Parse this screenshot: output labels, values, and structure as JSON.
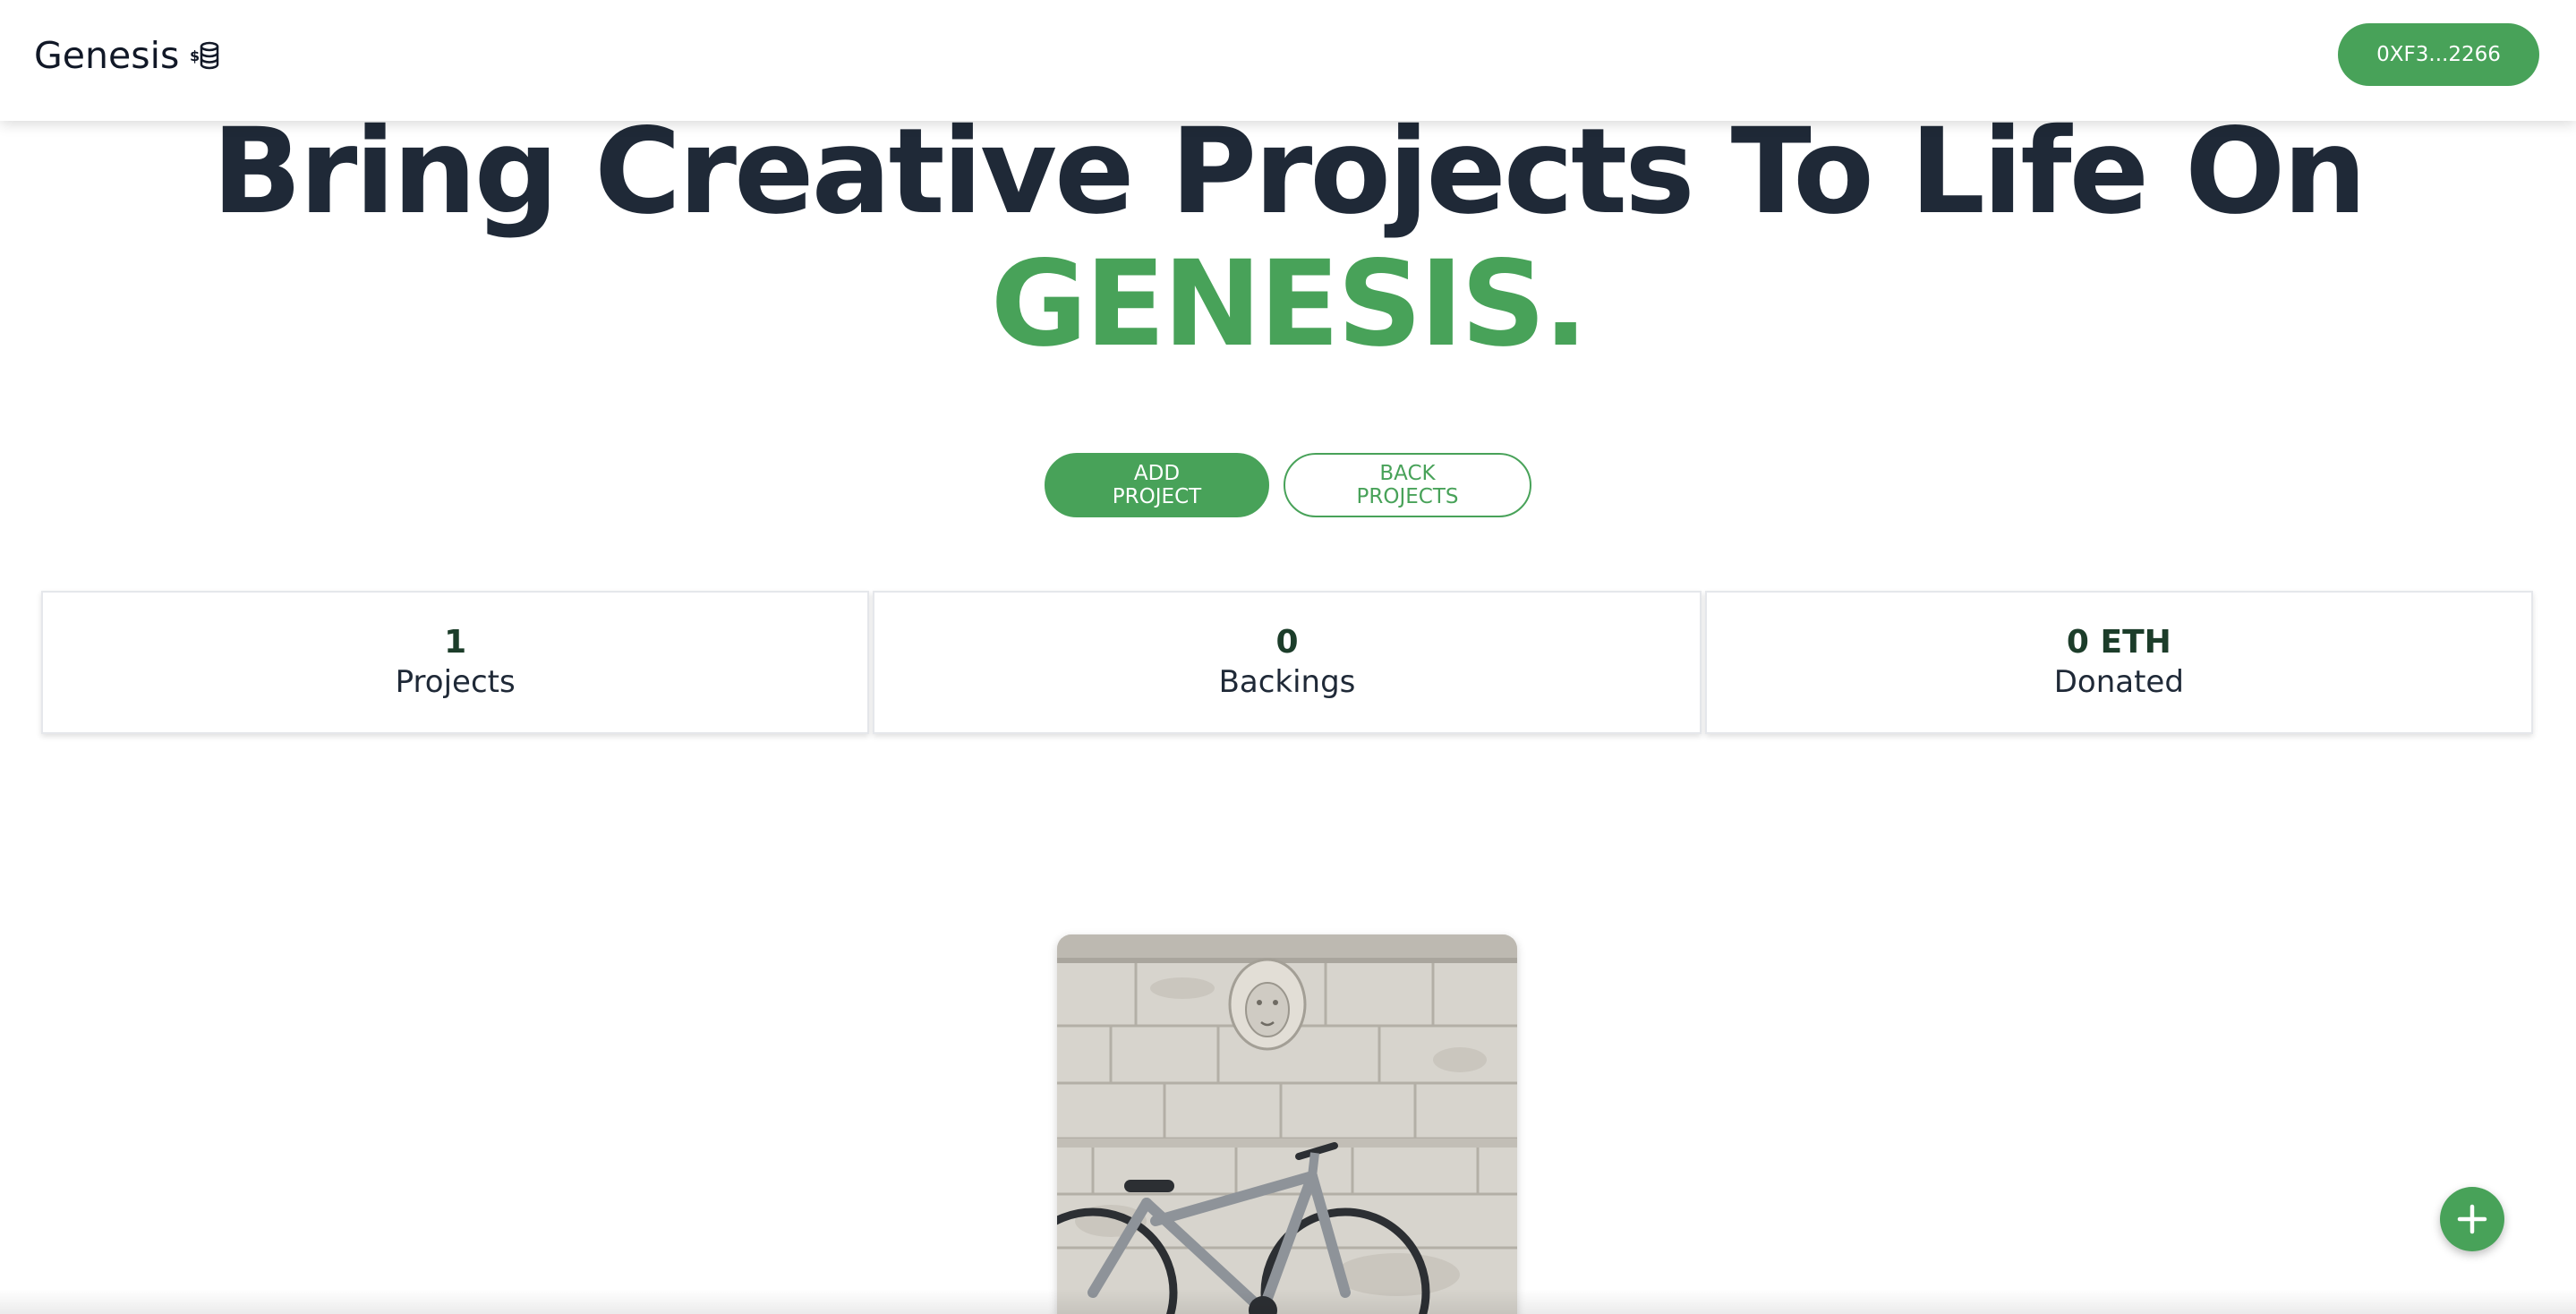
{
  "header": {
    "brand": "Genesis",
    "brand_icon": "coins-icon",
    "wallet_label": "0XF3...2266"
  },
  "hero": {
    "title_line": "Bring Creative Projects To Life On",
    "accent_word": "GENESIS."
  },
  "actions": {
    "add_project_label": "ADD PROJECT",
    "back_projects_label": "BACK PROJECTS"
  },
  "stats": [
    {
      "value": "1",
      "label": "Projects"
    },
    {
      "value": "0",
      "label": "Backings"
    },
    {
      "value": "0 ETH",
      "label": "Donated"
    }
  ],
  "projects": [
    {
      "image": "bicycle-against-stone-wall-with-lion-head"
    }
  ],
  "fab": {
    "icon": "plus-icon"
  },
  "colors": {
    "accent": "#48a259",
    "heading": "#1f2937",
    "stat_value": "#1c3d2a",
    "background": "#ffffff"
  }
}
